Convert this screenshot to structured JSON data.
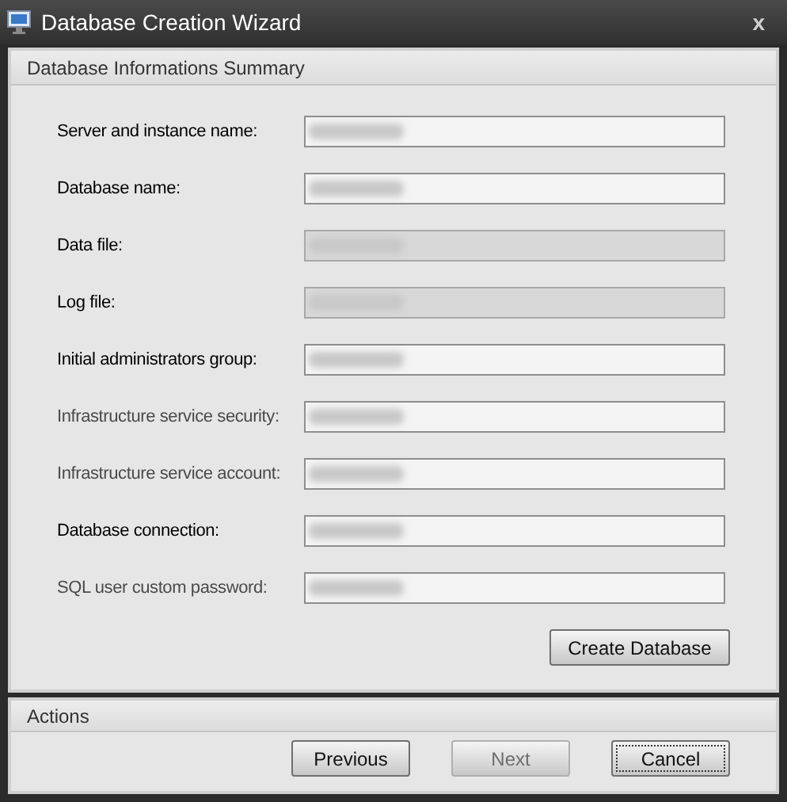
{
  "window": {
    "title": "Database Creation Wizard",
    "close": "x"
  },
  "summary": {
    "title": "Database Informations Summary",
    "rows": [
      {
        "label": "Server and instance name:",
        "label_disabled": false,
        "field_disabled": false,
        "redacted": true
      },
      {
        "label": "Database name:",
        "label_disabled": false,
        "field_disabled": false,
        "redacted": true
      },
      {
        "label": "Data file:",
        "label_disabled": false,
        "field_disabled": true,
        "redacted": true
      },
      {
        "label": "Log file:",
        "label_disabled": false,
        "field_disabled": true,
        "redacted": true
      },
      {
        "label": "Initial administrators group:",
        "label_disabled": false,
        "field_disabled": false,
        "redacted": true
      },
      {
        "label": "Infrastructure service security:",
        "label_disabled": true,
        "field_disabled": false,
        "redacted": true
      },
      {
        "label": "Infrastructure service account:",
        "label_disabled": true,
        "field_disabled": false,
        "redacted": true
      },
      {
        "label": "Database connection:",
        "label_disabled": false,
        "field_disabled": false,
        "redacted": true
      },
      {
        "label": "SQL user custom password:",
        "label_disabled": true,
        "field_disabled": false,
        "redacted": true
      }
    ],
    "create_button": "Create Database"
  },
  "actions": {
    "title": "Actions",
    "buttons": [
      {
        "label": "Previous",
        "disabled": false,
        "focused": false
      },
      {
        "label": "Next",
        "disabled": true,
        "focused": false
      },
      {
        "label": "Cancel",
        "disabled": false,
        "focused": true
      }
    ]
  }
}
